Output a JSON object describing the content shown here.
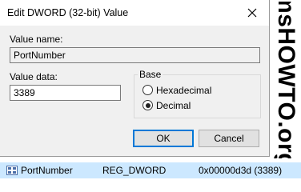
{
  "dialog": {
    "title": "Edit DWORD (32-bit) Value",
    "value_name_label": "Value name:",
    "value_name": "PortNumber",
    "value_data_label": "Value data:",
    "value_data": "3389",
    "base": {
      "label": "Base",
      "options": [
        {
          "label": "Hexadecimal",
          "selected": false
        },
        {
          "label": "Decimal",
          "selected": true
        }
      ]
    },
    "ok_label": "OK",
    "cancel_label": "Cancel"
  },
  "watermark": "msHOWTO.org",
  "registry_row": {
    "name": "PortNumber",
    "type": "REG_DWORD",
    "data": "0x00000d3d (3389)"
  },
  "colors": {
    "dialog_bg": "#f0f0f0",
    "selection_bg": "#cce8ff",
    "default_button_border": "#0078d7"
  }
}
